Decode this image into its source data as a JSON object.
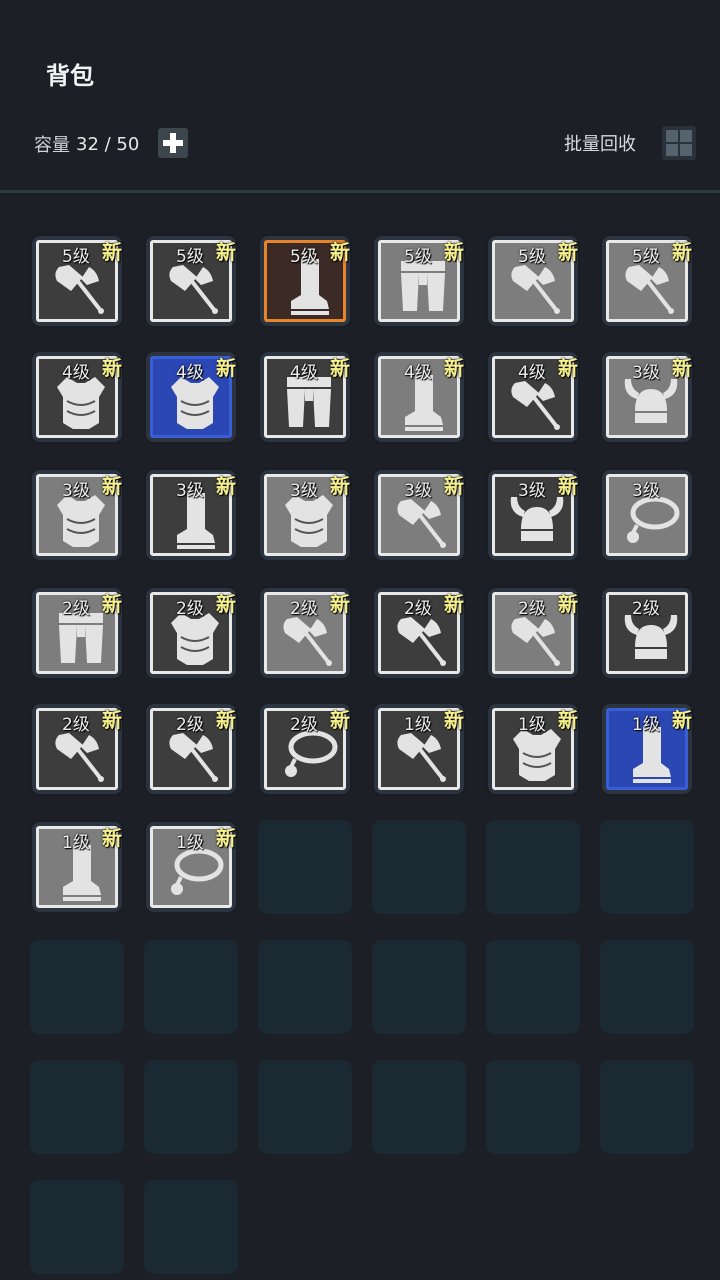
{
  "header": {
    "title": "背包"
  },
  "capacity": {
    "label": "容量",
    "value": "32 / 50"
  },
  "toolbar": {
    "add_icon": "plus-icon",
    "recycle_label": "批量回收",
    "grid_icon": "grid-view-icon"
  },
  "colors": {
    "bg_gray": "#7d7d7d",
    "bg_dark": "#3d3d3d",
    "bg_brown": "#3b2a26",
    "bg_blue": "#2a47b4",
    "border_white": "#e8e8e8",
    "border_orange": "#e8842a",
    "border_blue": "#3a5ed6",
    "new_badge": "#f6f08c",
    "empty_slot": "#1b2a32"
  },
  "inventory": {
    "total_slots": 50,
    "items": [
      {
        "type": "axe",
        "level": "5级",
        "new": "新",
        "bg": "dark",
        "frame": "white"
      },
      {
        "type": "axe",
        "level": "5级",
        "new": "新",
        "bg": "dark",
        "frame": "white"
      },
      {
        "type": "boot",
        "level": "5级",
        "new": "新",
        "bg": "brown",
        "frame": "orange"
      },
      {
        "type": "pants",
        "level": "5级",
        "new": "新",
        "bg": "gray",
        "frame": "white"
      },
      {
        "type": "axe",
        "level": "5级",
        "new": "新",
        "bg": "gray",
        "frame": "white"
      },
      {
        "type": "axe",
        "level": "5级",
        "new": "新",
        "bg": "gray",
        "frame": "white"
      },
      {
        "type": "armor",
        "level": "4级",
        "new": "新",
        "bg": "dark",
        "frame": "white"
      },
      {
        "type": "armor",
        "level": "4级",
        "new": "新",
        "bg": "blue",
        "frame": "blue"
      },
      {
        "type": "pants",
        "level": "4级",
        "new": "新",
        "bg": "dark",
        "frame": "white"
      },
      {
        "type": "boot",
        "level": "4级",
        "new": "新",
        "bg": "gray",
        "frame": "white"
      },
      {
        "type": "axe",
        "level": "4级",
        "new": "新",
        "bg": "dark",
        "frame": "white"
      },
      {
        "type": "helmet",
        "level": "3级",
        "new": "新",
        "bg": "gray",
        "frame": "white"
      },
      {
        "type": "armor",
        "level": "3级",
        "new": "新",
        "bg": "gray",
        "frame": "white"
      },
      {
        "type": "boot",
        "level": "3级",
        "new": "新",
        "bg": "dark",
        "frame": "white"
      },
      {
        "type": "armor",
        "level": "3级",
        "new": "新",
        "bg": "gray",
        "frame": "white"
      },
      {
        "type": "axe",
        "level": "3级",
        "new": "新",
        "bg": "gray",
        "frame": "white"
      },
      {
        "type": "helmet",
        "level": "3级",
        "new": "新",
        "bg": "dark",
        "frame": "white"
      },
      {
        "type": "necklace",
        "level": "3级",
        "new": "",
        "bg": "gray",
        "frame": "white"
      },
      {
        "type": "pants",
        "level": "2级",
        "new": "新",
        "bg": "gray",
        "frame": "white"
      },
      {
        "type": "armor",
        "level": "2级",
        "new": "新",
        "bg": "dark",
        "frame": "white"
      },
      {
        "type": "axe",
        "level": "2级",
        "new": "新",
        "bg": "gray",
        "frame": "white"
      },
      {
        "type": "axe",
        "level": "2级",
        "new": "新",
        "bg": "dark",
        "frame": "white"
      },
      {
        "type": "axe",
        "level": "2级",
        "new": "新",
        "bg": "gray",
        "frame": "white"
      },
      {
        "type": "helmet",
        "level": "2级",
        "new": "",
        "bg": "dark",
        "frame": "white"
      },
      {
        "type": "axe",
        "level": "2级",
        "new": "新",
        "bg": "dark",
        "frame": "white"
      },
      {
        "type": "axe",
        "level": "2级",
        "new": "新",
        "bg": "dark",
        "frame": "white"
      },
      {
        "type": "necklace",
        "level": "2级",
        "new": "新",
        "bg": "dark",
        "frame": "white"
      },
      {
        "type": "axe",
        "level": "1级",
        "new": "新",
        "bg": "dark",
        "frame": "white"
      },
      {
        "type": "armor",
        "level": "1级",
        "new": "新",
        "bg": "dark",
        "frame": "white"
      },
      {
        "type": "boot",
        "level": "1级",
        "new": "新",
        "bg": "blue",
        "frame": "blue"
      },
      {
        "type": "boot",
        "level": "1级",
        "new": "新",
        "bg": "gray",
        "frame": "white"
      },
      {
        "type": "necklace",
        "level": "1级",
        "new": "新",
        "bg": "gray",
        "frame": "white"
      }
    ]
  }
}
